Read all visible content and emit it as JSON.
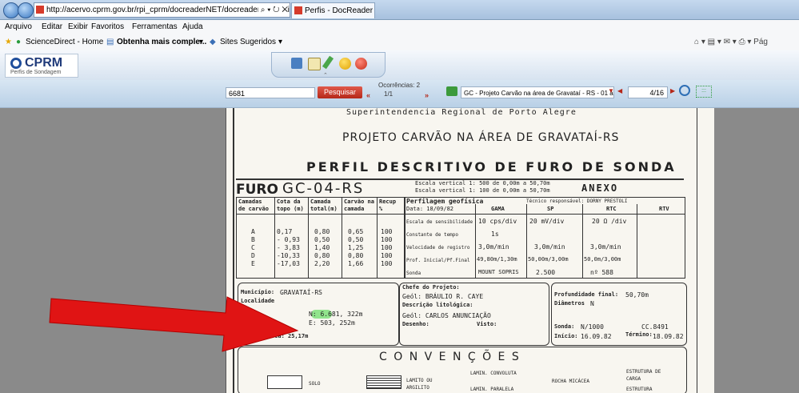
{
  "browser": {
    "address": "http://acervo.cprm.gov.br/rpi_cprm/docreaderNET/docreader.aspx?bi",
    "address_controls": "⌕ ▾ ↻ ✕",
    "tab_title": "Perfis - DocReader LIGHT",
    "menu": [
      "Arquivo",
      "Editar",
      "Exibir",
      "Favoritos",
      "Ferramentas",
      "Ajuda"
    ],
    "favorites": {
      "fav1": "ScienceDirect - Home",
      "fav2": "Obtenha mais comple...",
      "fav2_arrow": "▾",
      "fav3": "Sites Sugeridos",
      "fav3_arrow": "▾",
      "right": "⌂ ▾ ▤ ▾ ✉ ▾ ⎙ ▾ Pág"
    }
  },
  "app": {
    "logo": "CPRM",
    "subtitle": "Perfis de Sondagem"
  },
  "toolbar": {
    "search_value": "6681",
    "search_button": "Pesquisar",
    "occurrences_label": "Ocorrências: 2",
    "occurrences_pos": "1/1",
    "document_name": "GC - Projeto Carvão na área de Gravataí - RS - 01 a",
    "page": "4/16"
  },
  "doc": {
    "header_top": "Superintendencia Regional de Porto Alegre",
    "title1": "PROJETO CARVÃO NA ÁREA DE GRAVATAÍ-RS",
    "title2": "PERFIL DESCRITIVO DE FURO DE SONDA",
    "furo_label": "FURO",
    "furo_code": "GC-04-RS",
    "escala1": "Escala vertical 1: 500 de 0,00m a 50,70m",
    "escala2": "Escala vertical 1: 100 de 0,00m a 50,70m",
    "anexo": "ANEXO",
    "col_camadas": "Camadas\nde carvão",
    "col_cota": "Cota da\ntopo (m)",
    "col_espessura": "Camada\ntotal(m)",
    "col_carvao": "Carvão na\ncamada",
    "col_recup": "Recup\n%",
    "perfilagem": "Perfilagem geofísica",
    "data_label": "Data: 18/09/82",
    "tecnico": "Técnico responsável: DORNY PRESTOLI",
    "gama": "GAMA",
    "sp": "SP",
    "rtc": "RTC",
    "rtv": "RTV",
    "rows": [
      {
        "camada": "A",
        "cota": "0,17",
        "total": "0,80",
        "carvao": "0,65",
        "recup": "100"
      },
      {
        "camada": "B",
        "cota": "- 0,93",
        "total": "0,50",
        "carvao": "0,50",
        "recup": "100"
      },
      {
        "camada": "C",
        "cota": "- 3,83",
        "total": "1,40",
        "carvao": "1,25",
        "recup": "100"
      },
      {
        "camada": "D",
        "cota": "-10,33",
        "total": "0,80",
        "carvao": "0,80",
        "recup": "100"
      },
      {
        "camada": "E",
        "cota": "-17,03",
        "total": "2,20",
        "carvao": "1,66",
        "recup": "100"
      }
    ],
    "params": [
      {
        "label": "Escala de sensibilidade",
        "gama": "10 cps/div",
        "sp": "20 mV/div",
        "rtc": "20 Ω /div"
      },
      {
        "label": "Constante de tempo",
        "gama": "1s",
        "sp": "",
        "rtc": ""
      },
      {
        "label": "Velocidade de registro",
        "gama": "3,0m/min",
        "sp": "3,0m/min",
        "rtc": "3,0m/min"
      },
      {
        "label": "Prof. Inicial/Pf.Final",
        "gama": "49,80m/1,30m",
        "sp": "50,00m/3,00m",
        "rtc": "50,0m/3,00m"
      },
      {
        "label": "Sonda",
        "gama": "MOUNT SOPRIS",
        "sp": "2.500",
        "rtc": "nº 588"
      }
    ],
    "municipio_label": "Município:",
    "municipio": "GRAVATAÍ-RS",
    "localidade_label": "Localidade",
    "coord_n": "N: 6.681, 322m",
    "coord_e": "E: 503, 252m",
    "cota_boca": "Cota da boca: 25,17m",
    "chefe_label": "Chefe do Projeto:",
    "chefe": "Geól: BRÁULIO R. CAYE",
    "descricao_label": "Descrição litológica:",
    "descricao": "Geól: CARLOS ANUNCIAÇÃO",
    "desenho_label": "Desenho:",
    "visto_label": "Visto:",
    "prof_final_label": "Profundidade final:",
    "prof_final": "50,70m",
    "diametros_label": "Diâmetros",
    "diametros": "N",
    "sonda_label": "Sonda:",
    "sonda": "N/1000",
    "sonda_cc": "CC.8491",
    "inicio_label": "Início:",
    "inicio": "16.09.82",
    "termino_label": "Término:",
    "termino": "18.09.82",
    "convencoes": "C O N V E N Ç Õ E S",
    "legend": [
      "SOLO",
      "LAMITO OU ARGILITO",
      "LAMIN. CONVOLUTA",
      "LAMIN. PARALELA",
      "ROCHA MICÁCEA",
      "ESTRUTURA DE CARGA",
      "ESTRUTURA"
    ]
  }
}
